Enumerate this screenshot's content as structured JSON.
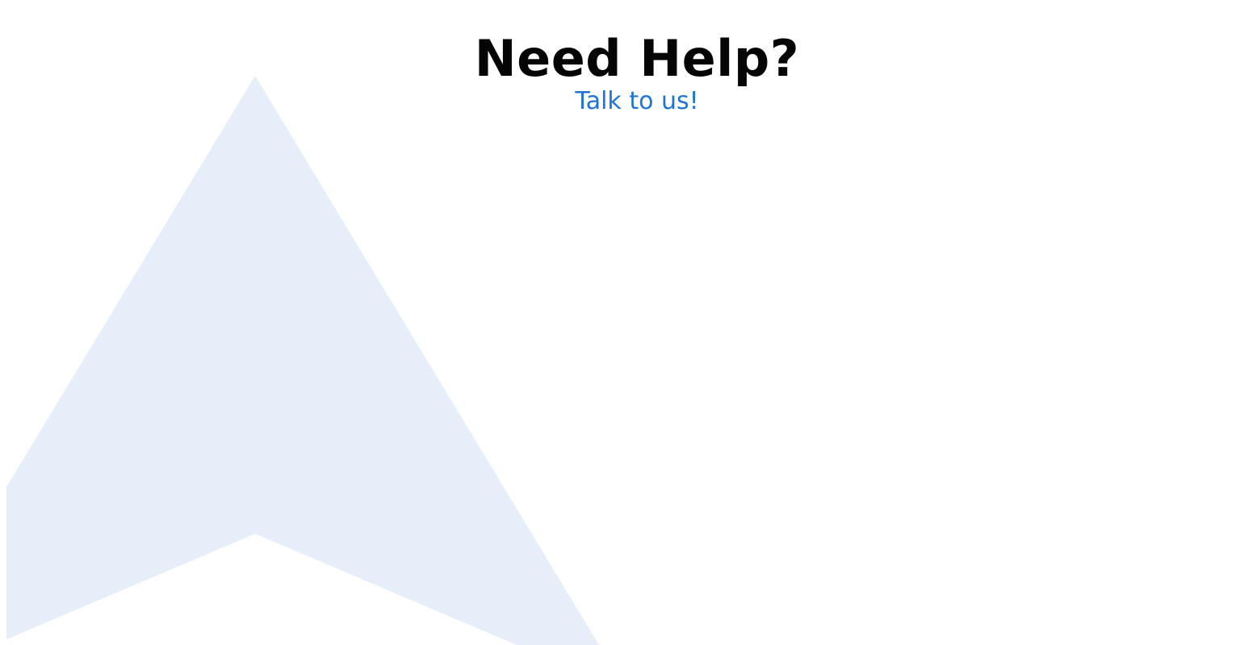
{
  "header": {
    "title": "Need Help?",
    "subtitle": "Talk to us!"
  },
  "colors": {
    "background": "#ffffff",
    "title": "#050505",
    "accent": "#1f74d4",
    "shape_fill": "#e6eff9"
  },
  "decor": {
    "shape": "navigation-arrow-icon"
  }
}
